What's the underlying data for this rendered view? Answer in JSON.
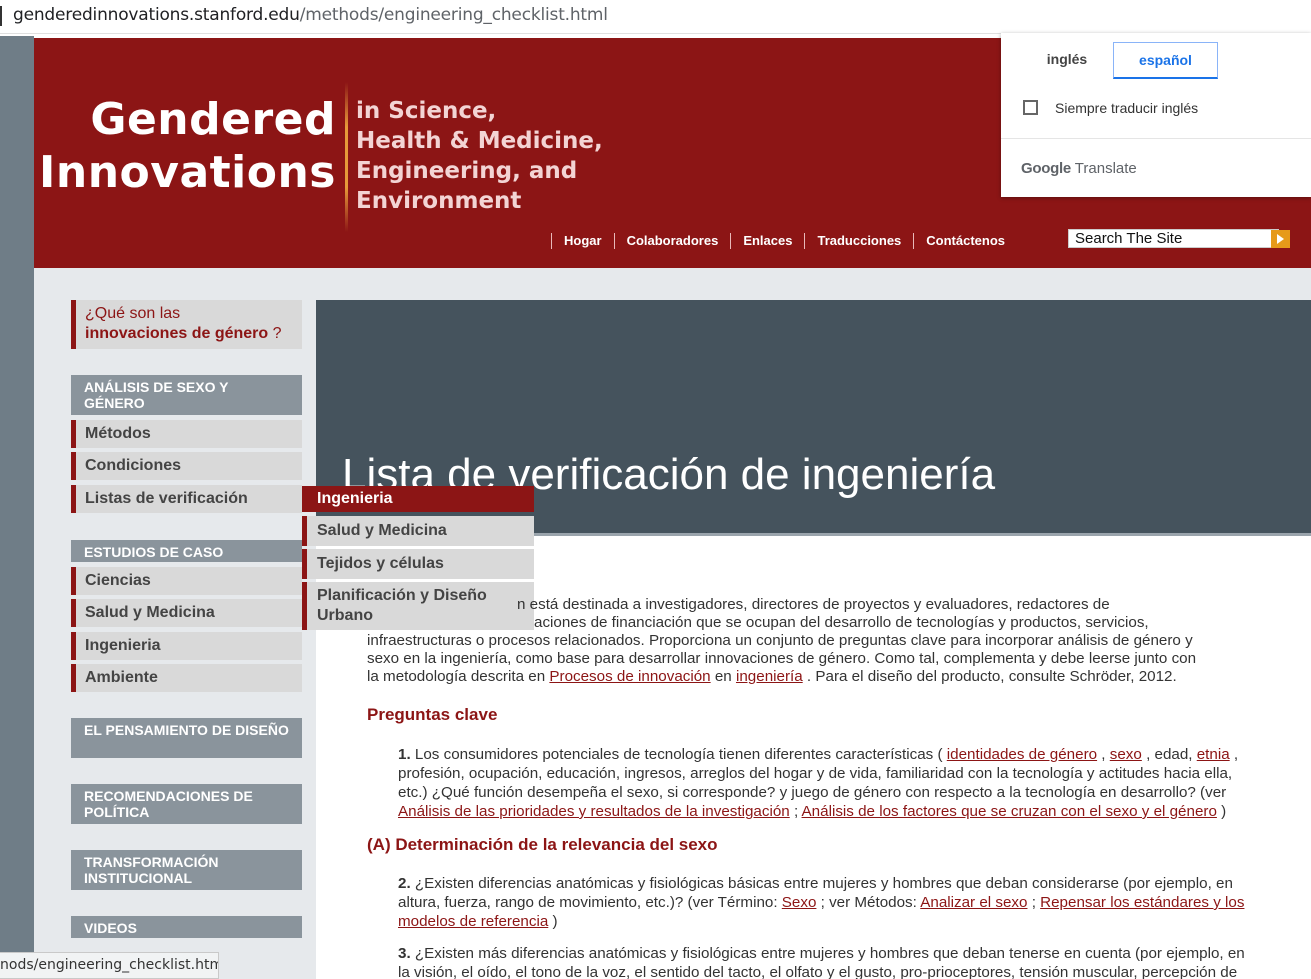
{
  "browser": {
    "url_domain": "genderedinnovations.stanford.edu",
    "url_path": "/methods/engineering_checklist.html",
    "status_url": "nods/engineering_checklist.html"
  },
  "header": {
    "logo_line1": "Gendered",
    "logo_line2": "Innovations",
    "logo_sub": [
      "in Science,",
      "Health & Medicine,",
      "Engineering, and",
      "Environment"
    ],
    "nav": [
      "Hogar",
      "Colaboradores",
      "Enlaces",
      "Traducciones",
      "Contáctenos"
    ],
    "search_value": "Search The Site"
  },
  "translate": {
    "tab_source": "inglés",
    "tab_target": "español",
    "always_label": "Siempre traducir inglés",
    "brand_google": "Google",
    "brand_translate": "Translate"
  },
  "sidebar": {
    "what_prefix": "¿Qué son las",
    "what_bold": "innovaciones de género",
    "what_suffix": " ?",
    "section1": "ANÁLISIS DE SEXO Y GÉNERO",
    "section1_items": [
      "Métodos",
      "Condiciones",
      "Listas de verificación"
    ],
    "section2": "ESTUDIOS DE CASO",
    "section2_items": [
      "Ciencias",
      "Salud y Medicina",
      "Ingenieria",
      "Ambiente"
    ],
    "section3": "EL PENSAMIENTO DE DISEÑO",
    "section4": "RECOMENDACIONES DE POLÍTICA",
    "section5": "TRANSFORMACIÓN INSTITUCIONAL",
    "section6": "VIDEOS"
  },
  "flyout": [
    "Ingenieria",
    "Salud y Medicina",
    "Tejidos y células",
    "Planificación y Diseño Urbano"
  ],
  "banner_title": "Lista de verificación de ingeniería",
  "article": {
    "intro_line1": "n está destinada a investigadores, directores de proyectos y evaluadores, redactores de",
    "intro_line2": "aciones de financiación que se ocupan del desarrollo de tecnologías y productos, servicios,",
    "intro_line3": "infraestructuras o procesos relacionados. Proporciona un conjunto de preguntas clave para incorporar análisis de género y",
    "intro_line4": "sexo en la ingeniería, como base para desarrollar innovaciones de género. Como tal, complementa y debe leerse junto con",
    "intro_line5a": "la metodología descrita en ",
    "intro_link1": "Procesos de innovación",
    "intro_line5b": " en ",
    "intro_link2": "ingeniería",
    "intro_line5c": " . Para el diseño del producto, consulte Schröder, 2012.",
    "h_preguntas": "Preguntas clave",
    "q1_num": "1.",
    "q1_a": " Los consumidores potenciales de tecnología tienen diferentes características ( ",
    "q1_l1": "identidades de género",
    "q1_b": " , ",
    "q1_l2": "sexo",
    "q1_c": " , edad, ",
    "q1_l3": "etnia",
    "q1_d": " ,",
    "q1_line2": "profesión, ocupación, educación, ingresos, arreglos del hogar y de vida, familiaridad con la tecnología y actitudes hacia ella,",
    "q1_line3": "etc.) ¿Qué función desempeña el sexo, si corresponde? y juego de género con respecto a la tecnología en desarrollo? (ver",
    "q1_l4": "Análisis de las prioridades y resultados de la investigación",
    "q1_e": " ; ",
    "q1_l5": "Análisis de los factores que se cruzan con el sexo y el género",
    "q1_f": " )",
    "h_a": "(A) Determinación de la relevancia del sexo",
    "q2_num": "2.",
    "q2_line1": " ¿Existen diferencias anatómicas y fisiológicas básicas entre mujeres y hombres que deban considerarse (por ejemplo, en",
    "q2_a": "altura, fuerza, rango de movimiento, etc.)? (ver Término: ",
    "q2_l1": "Sexo",
    "q2_b": " ; ver Métodos: ",
    "q2_l2": "Analizar el sexo",
    "q2_c": " ; ",
    "q2_l3": "Repensar los estándares y los",
    "q2_l4": "modelos de referencia",
    "q2_d": " )",
    "q3_num": "3.",
    "q3_line1": " ¿Existen más diferencias anatómicas y fisiológicas entre mujeres y hombres que deban tenerse en cuenta (por ejemplo, en",
    "q3_line2": "la visión, el oído, el tono de la voz, el sentido del tacto, el olfato y el gusto, pro-prioceptores, tensión muscular, percepción de"
  },
  "colors": {
    "brand_red": "#8c1515",
    "sidebar_header_gray": "#8a949c",
    "banner_slate": "#45535d",
    "google_blue": "#1a73e8"
  }
}
